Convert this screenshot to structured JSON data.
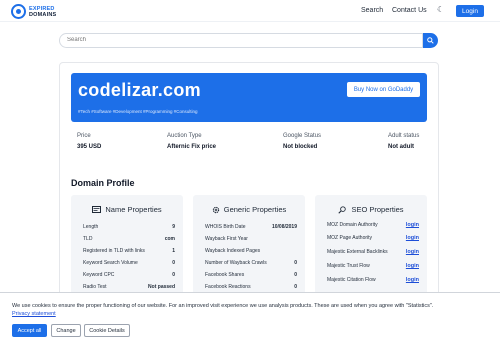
{
  "header": {
    "logo_line1": "EXPIRED",
    "logo_line2": "DOMAINS",
    "nav_search": "Search",
    "nav_contact": "Contact Us",
    "login_label": "Login"
  },
  "search": {
    "placeholder": "Search"
  },
  "domain": {
    "name": "codelizar.com",
    "tags": "#Tech  #Software  #Development  #Programming  #Consulting",
    "buy_label": "Buy Now on GoDaddy"
  },
  "info": [
    {
      "label": "Price",
      "value": "395 USD"
    },
    {
      "label": "Auction Type",
      "value": "Afternic Fix price"
    },
    {
      "label": "Google Status",
      "value": "Not blocked"
    },
    {
      "label": "Adult status",
      "value": "Not adult"
    }
  ],
  "profile": {
    "title": "Domain Profile",
    "name_properties": {
      "heading": "Name Properties",
      "rows": [
        {
          "label": "Length",
          "value": "9"
        },
        {
          "label": "TLD",
          "value": "com"
        },
        {
          "label": "Registered in TLD with links",
          "value": "1"
        },
        {
          "label": "Keyword Search Volume",
          "value": "0"
        },
        {
          "label": "Keyword CPC",
          "value": "0"
        },
        {
          "label": "Radio Test",
          "value": "Not passed"
        }
      ]
    },
    "generic_properties": {
      "heading": "Generic Properties",
      "rows": [
        {
          "label": "WHOIS Birth Date",
          "value": "10/08/2019"
        },
        {
          "label": "Wayback First Year",
          "value": ""
        },
        {
          "label": "Wayback Indexed Pages",
          "value": ""
        },
        {
          "label": "Number of Wayback Crawls",
          "value": "0"
        },
        {
          "label": "Facebook Shares",
          "value": "0"
        },
        {
          "label": "Facebook Reactions",
          "value": "0"
        }
      ]
    },
    "seo_properties": {
      "heading": "SEO Properties",
      "rows": [
        {
          "label": "MOZ Domain Authority",
          "value": "login"
        },
        {
          "label": "MOZ Page Authority",
          "value": "login"
        },
        {
          "label": "Majestic External Backlinks",
          "value": "login"
        },
        {
          "label": "Majestic Trust Flow",
          "value": "login"
        },
        {
          "label": "Majestic Citation Flow",
          "value": "login"
        }
      ]
    }
  },
  "cookie": {
    "text": "We use cookies to ensure the proper functioning of our website. For an improved visit experience we use analysis products. These are used when you agree with \"Statistics\".",
    "privacy_link": "Privacy statement",
    "accept_label": "Accept all",
    "change_label": "Change",
    "details_label": "Cookie Details"
  },
  "colors": {
    "accent": "#1d6fe8",
    "panel_bg": "#f3f5f8",
    "link": "#1d4ed8"
  }
}
